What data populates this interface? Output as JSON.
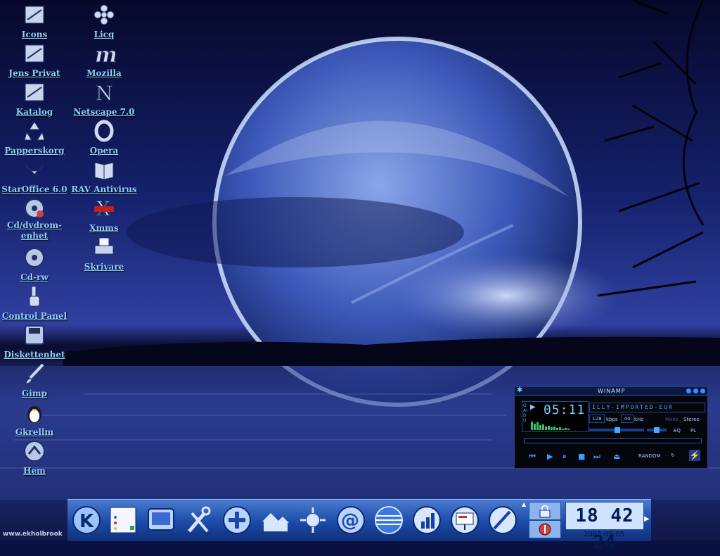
{
  "desktop": {
    "icons_left": [
      {
        "label": "Icons",
        "icon": "folder-icon"
      },
      {
        "label": "Jens Privat",
        "icon": "folder-icon"
      },
      {
        "label": "Katalog",
        "icon": "folder-icon"
      },
      {
        "label": "Papperskorg",
        "icon": "recycle-icon"
      },
      {
        "label": "StarOffice 6.0",
        "icon": "staroffice-icon"
      },
      {
        "label": "Cd/dvdrom-\nenhet",
        "icon": "cdrom-icon"
      },
      {
        "label": "Cd-rw",
        "icon": "cdrw-icon"
      },
      {
        "label": "Control Panel",
        "icon": "control-panel-icon"
      },
      {
        "label": "Diskettenhet",
        "icon": "floppy-icon"
      },
      {
        "label": "Gimp",
        "icon": "paintbrush-icon"
      },
      {
        "label": "Gkrellm",
        "icon": "penguin-icon"
      },
      {
        "label": "Hem",
        "icon": "home-icon"
      }
    ],
    "icons_right": [
      {
        "label": "Licq",
        "icon": "flower-icon"
      },
      {
        "label": "Mozilla",
        "icon": "mozilla-icon"
      },
      {
        "label": "Netscape 7.0",
        "icon": "netscape-icon"
      },
      {
        "label": "Opera",
        "icon": "opera-icon"
      },
      {
        "label": "RAV Antivirus",
        "icon": "book-icon"
      },
      {
        "label": "Xmms",
        "icon": "xmms-icon"
      },
      {
        "label": "Skrivare",
        "icon": "printer-icon"
      }
    ]
  },
  "credit": "www.ekholbrook",
  "winamp": {
    "title": "WINAMP",
    "time": "05:11",
    "marquee": "ILLY-IMPORTED-EUR",
    "bitrate": "128",
    "bitrate_unit": "kbps",
    "samplerate": "44",
    "samplerate_unit": "kHz",
    "mono": "Mono",
    "stereo": "Stereo",
    "eq": "EQ",
    "pl": "PL",
    "random": "RANDOM",
    "side_label": "OAIDU"
  },
  "panel": {
    "clock": "18 42 24",
    "date": "2002-09-05",
    "buttons": [
      "kde-menu-icon",
      "notes-icon",
      "desktop-icon",
      "tools-icon",
      "plus-icon",
      "homes-icon",
      "network-icon",
      "at-mail-icon",
      "globe-icon",
      "chart-icon",
      "presentation-icon",
      "draw-icon"
    ]
  },
  "colors": {
    "label": "#8fd0ff",
    "panel": "#2a5ac0",
    "winamp_accent": "#3a9cff"
  }
}
